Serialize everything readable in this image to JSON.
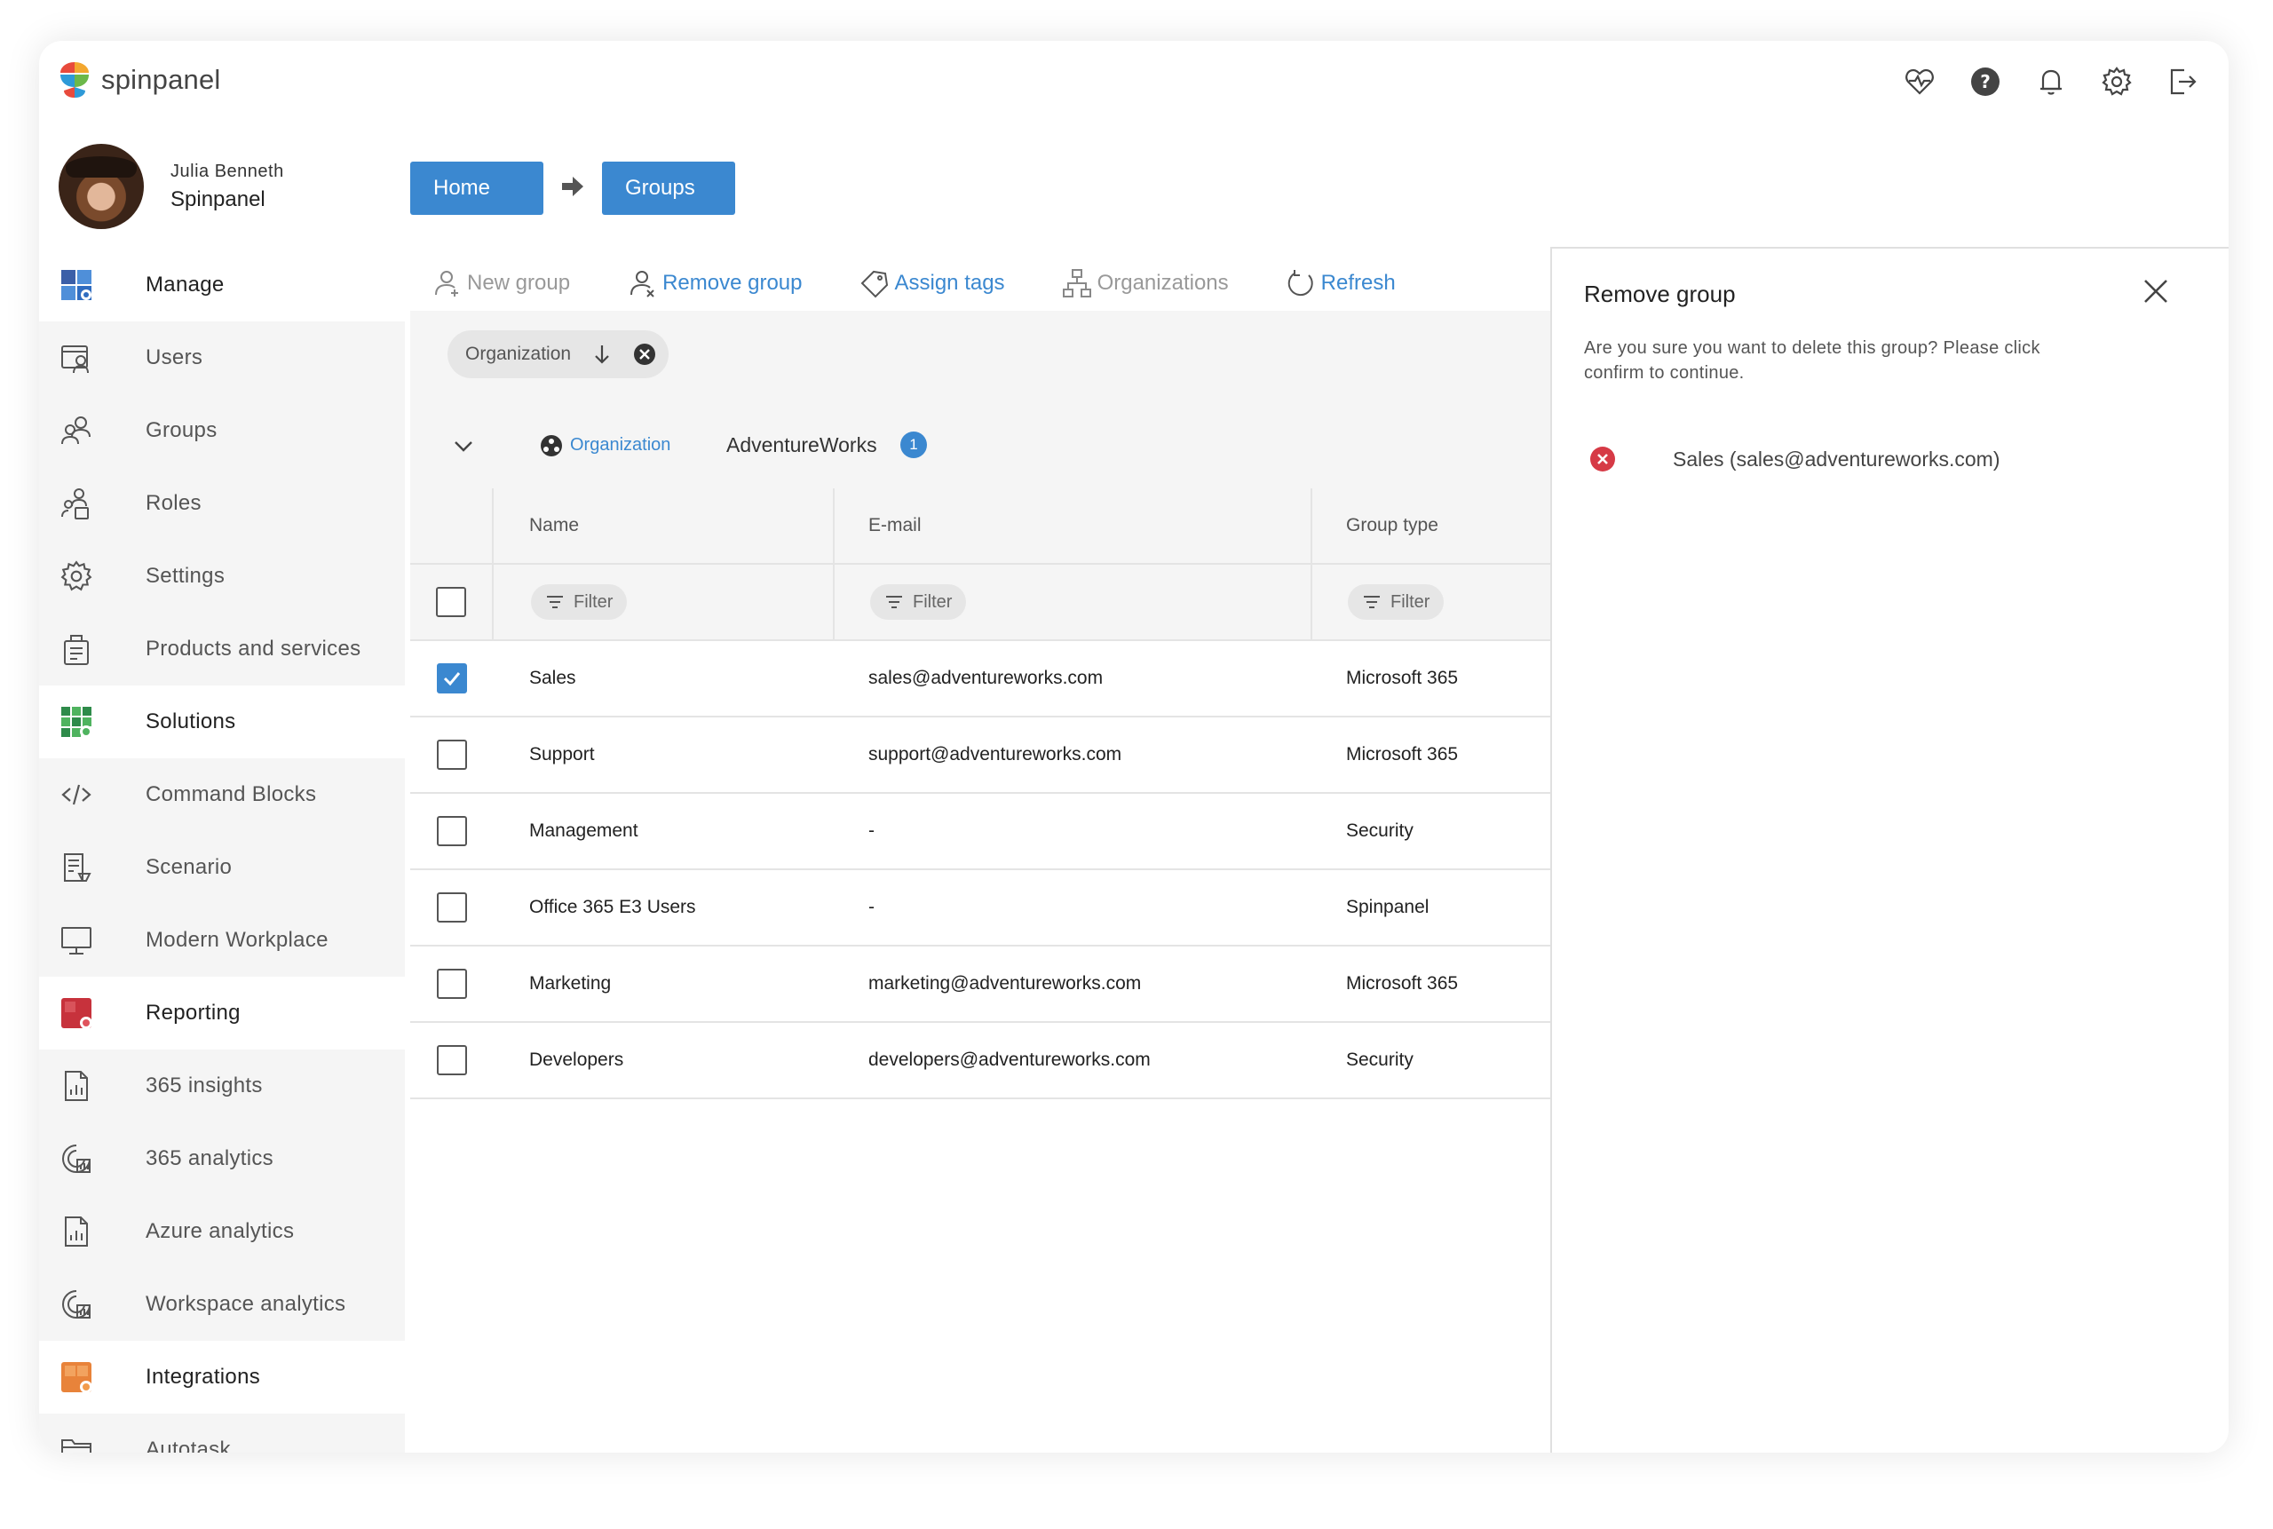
{
  "app": {
    "brand": "spinpanel"
  },
  "profile": {
    "name": "Julia Benneth",
    "org": "Spinpanel"
  },
  "top_icons": [
    "health-icon",
    "help-icon",
    "bell-icon",
    "gear-icon",
    "logout-icon"
  ],
  "sidebar": {
    "items": [
      {
        "label": "Manage",
        "type": "section",
        "icon": "manage-icon"
      },
      {
        "label": "Users",
        "type": "sub",
        "icon": "users-icon"
      },
      {
        "label": "Groups",
        "type": "sub",
        "icon": "groups-icon"
      },
      {
        "label": "Roles",
        "type": "sub",
        "icon": "roles-icon"
      },
      {
        "label": "Settings",
        "type": "sub",
        "icon": "settings-icon"
      },
      {
        "label": "Products and services",
        "type": "sub",
        "icon": "products-icon"
      },
      {
        "label": "Solutions",
        "type": "section",
        "icon": "solutions-icon"
      },
      {
        "label": "Command Blocks",
        "type": "sub",
        "icon": "code-icon"
      },
      {
        "label": "Scenario",
        "type": "sub",
        "icon": "scenario-icon"
      },
      {
        "label": "Modern Workplace",
        "type": "sub",
        "icon": "monitor-icon"
      },
      {
        "label": "Reporting",
        "type": "section",
        "icon": "reporting-icon"
      },
      {
        "label": "365 insights",
        "type": "sub",
        "icon": "report-doc-icon"
      },
      {
        "label": "365 analytics",
        "type": "sub",
        "icon": "analytics-icon"
      },
      {
        "label": "Azure analytics",
        "type": "sub",
        "icon": "report-doc-icon"
      },
      {
        "label": "Workspace analytics",
        "type": "sub",
        "icon": "analytics-icon"
      },
      {
        "label": "Integrations",
        "type": "section",
        "icon": "integrations-icon"
      },
      {
        "label": "Autotask",
        "type": "sub",
        "icon": "folder-icon"
      }
    ]
  },
  "breadcrumb": {
    "home": "Home",
    "current": "Groups"
  },
  "toolbar": {
    "new_group": "New group",
    "remove_group": "Remove group",
    "assign_tags": "Assign tags",
    "organizations": "Organizations",
    "refresh": "Refresh"
  },
  "grouping": {
    "chip_label": "Organization",
    "group_field": "Organization",
    "group_value": "AdventureWorks",
    "count": "1"
  },
  "table": {
    "columns": [
      "Name",
      "E-mail",
      "Group type"
    ],
    "filter_label": "Filter",
    "rows": [
      {
        "name": "Sales",
        "email": "sales@adventureworks.com",
        "type": "Microsoft 365",
        "checked": true
      },
      {
        "name": "Support",
        "email": "support@adventureworks.com",
        "type": "Microsoft 365",
        "checked": false
      },
      {
        "name": "Management",
        "email": "-",
        "type": "Security",
        "checked": false
      },
      {
        "name": "Office 365 E3 Users",
        "email": "-",
        "type": "Spinpanel",
        "checked": false
      },
      {
        "name": "Marketing",
        "email": "marketing@adventureworks.com",
        "type": "Microsoft 365",
        "checked": false
      },
      {
        "name": "Developers",
        "email": "developers@adventureworks.com",
        "type": "Security",
        "checked": false
      }
    ]
  },
  "panel": {
    "title": "Remove group",
    "message": "Are you sure you want to delete this group? Please click confirm to continue.",
    "item": "Sales (sales@adventureworks.com)"
  },
  "colors": {
    "accent": "#3b88d0",
    "error": "#d63a46",
    "section_bg": "#ffffff",
    "sub_bg": "#f5f5f5"
  }
}
